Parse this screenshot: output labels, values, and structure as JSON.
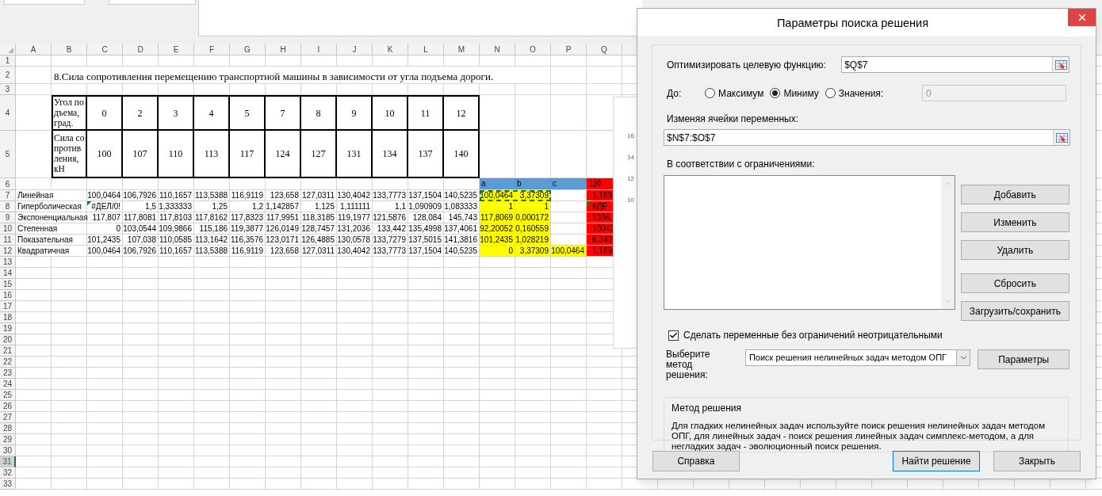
{
  "sheet": {
    "columns": [
      "A",
      "B",
      "C",
      "D",
      "E",
      "F",
      "G",
      "H",
      "I",
      "J",
      "K",
      "L",
      "M",
      "N",
      "O",
      "P",
      "Q"
    ],
    "rows": [
      {
        "label": "1",
        "selected": false
      },
      {
        "label": "2",
        "selected": false
      },
      {
        "label": "3",
        "selected": false
      },
      {
        "label": "4",
        "selected": false
      },
      {
        "label": "5",
        "selected": false
      },
      {
        "label": "6",
        "selected": false
      },
      {
        "label": "7",
        "selected": false
      },
      {
        "label": "8",
        "selected": false
      },
      {
        "label": "9",
        "selected": false
      },
      {
        "label": "10",
        "selected": false
      },
      {
        "label": "11",
        "selected": false
      },
      {
        "label": "12",
        "selected": false
      },
      {
        "label": "13",
        "selected": false
      },
      {
        "label": "14",
        "selected": false
      },
      {
        "label": "15",
        "selected": false
      },
      {
        "label": "16",
        "selected": false
      },
      {
        "label": "17",
        "selected": false
      },
      {
        "label": "18",
        "selected": false
      },
      {
        "label": "19",
        "selected": false
      },
      {
        "label": "20",
        "selected": false
      },
      {
        "label": "21",
        "selected": false
      },
      {
        "label": "22",
        "selected": false
      },
      {
        "label": "23",
        "selected": false
      },
      {
        "label": "24",
        "selected": false
      },
      {
        "label": "25",
        "selected": false
      },
      {
        "label": "26",
        "selected": false
      },
      {
        "label": "27",
        "selected": false
      },
      {
        "label": "28",
        "selected": false
      },
      {
        "label": "29",
        "selected": false
      },
      {
        "label": "30",
        "selected": false
      },
      {
        "label": "31",
        "selected": true
      },
      {
        "label": "32",
        "selected": false
      },
      {
        "label": "33",
        "selected": false
      }
    ],
    "title": "8.Сила сопротивления перемещению транспортной машины в зависимости от угла подъема дороги.",
    "input_table": [
      {
        "label": "Угол подъема, град.",
        "values": [
          "0",
          "2",
          "3",
          "4",
          "5",
          "7",
          "8",
          "9",
          "10",
          "11",
          "12"
        ]
      },
      {
        "label": "Сила сопротивления, кН",
        "values": [
          "100",
          "107",
          "110",
          "113",
          "117",
          "124",
          "127",
          "131",
          "134",
          "137",
          "140"
        ]
      }
    ],
    "coefficient_headers": [
      "a",
      "b",
      "c"
    ],
    "objective_header": "ЦФ",
    "models": [
      {
        "name": "Линейная",
        "values": [
          "100,0464",
          "106,7926",
          "110,1657",
          "113,5388",
          "116,9119",
          "123,658",
          "127,0311",
          "130,4042",
          "133,7773",
          "137,1504",
          "140,5235"
        ],
        "coefficients": [
          "100,0464",
          "3,37309"
        ],
        "objective": "1,189",
        "flagged": false,
        "objective_flagged": false,
        "copy_marquee": true
      },
      {
        "name": "Гиперболическая",
        "values": [
          "#ДЕЛ/0!",
          "1,5",
          "1,333333",
          "1,25",
          "1,2",
          "1,142857",
          "1,125",
          "1,111111",
          "1,1",
          "1,090909",
          "1,083333"
        ],
        "coefficients": [
          "1",
          "1"
        ],
        "objective": "#ДЕ",
        "flagged": true,
        "objective_flagged": true,
        "copy_marquee": false
      },
      {
        "name": "Экспоненциальная",
        "values": [
          "117,807",
          "117,8081",
          "117,8103",
          "117,8162",
          "117,8323",
          "117,9951",
          "118,3185",
          "119,1977",
          "121,5876",
          "128,084",
          "145,743"
        ],
        "coefficients": [
          "117,8069",
          "0,000172"
        ],
        "objective": "1036,",
        "flagged": false,
        "objective_flagged": false,
        "copy_marquee": false
      },
      {
        "name": "Степенная",
        "values": [
          "0",
          "103,0544",
          "109,9866",
          "115,186",
          "119,3877",
          "126,0149",
          "128,7457",
          "131,2036",
          "133,442",
          "135,4998",
          "137,4061"
        ],
        "coefficients": [
          "92,20052",
          "0,160559"
        ],
        "objective": "10042",
        "flagged": false,
        "objective_flagged": false,
        "copy_marquee": false
      },
      {
        "name": "Показательная",
        "values": [
          "101,2435",
          "107,038",
          "110,0585",
          "113,1642",
          "116,3576",
          "123,0171",
          "126,4885",
          "130,0578",
          "133,7279",
          "137,5015",
          "141,3816"
        ],
        "coefficients": [
          "101,2435",
          "1,028219"
        ],
        "objective": "6,340",
        "flagged": false,
        "objective_flagged": false,
        "copy_marquee": false
      },
      {
        "name": "Квадратичная",
        "values": [
          "100,0464",
          "106,7926",
          "110,1657",
          "113,5388",
          "116,9119",
          "123,658",
          "127,0311",
          "130,4042",
          "133,7773",
          "137,1504",
          "140,5235"
        ],
        "coefficients": [
          "0",
          "3,37309",
          "100,0464"
        ],
        "objective": "1,189",
        "flagged": false,
        "objective_flagged": false,
        "copy_marquee": false
      }
    ],
    "chart_fragment": {
      "tick_labels": [
        "16",
        "14",
        "12",
        "10"
      ]
    }
  },
  "dialog": {
    "title": "Параметры поиска решения",
    "objective_label": "Оптимизировать целевую функцию:",
    "objective_value": "$Q$7",
    "to_label": "До:",
    "options": [
      {
        "label": "Максимум",
        "selected": false
      },
      {
        "label": "Миниму",
        "selected": true
      },
      {
        "label": "Значения:",
        "selected": false
      }
    ],
    "target_value": {
      "value": "0",
      "disabled": true
    },
    "variables_label": "Изменяя ячейки переменных:",
    "variables_value": "$N$7:$O$7",
    "constraints_label": "В соответствии с ограничениями:",
    "side_buttons": [
      "Добавить",
      "Изменить",
      "Удалить",
      "Сбросить",
      "Загрузить/сохранить"
    ],
    "nonnegative": {
      "label": "Сделать переменные без ограничений неотрицательными",
      "checked": true
    },
    "method_label": "Выберите метод решения:",
    "method_value": "Поиск решения нелинейных задач методом ОПГ",
    "params_button": "Параметры",
    "method_group": {
      "title": "Метод решения",
      "text": "Для гладких нелинейных задач используйте поиск решения нелинейных задач методом ОПГ, для линейных задач - поиск решения линейных задач симплекс-методом, а для негладких задач - эволюционный поиск решения."
    },
    "buttons": [
      {
        "label": "Справка",
        "default": false
      },
      {
        "label": "Найти решение",
        "default": true
      },
      {
        "label": "Закрыть",
        "default": false
      }
    ]
  }
}
